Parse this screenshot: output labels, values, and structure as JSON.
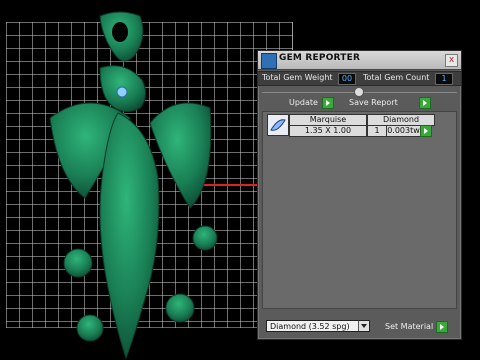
{
  "panel": {
    "title": "GEM REPORTER",
    "close_label": "x",
    "total_weight_label": "Total Gem Weight",
    "total_weight_value": "00",
    "total_count_label": "Total Gem Count",
    "total_count_value": "1",
    "update_label": "Update",
    "save_report_label": "Save Report"
  },
  "gem_row": {
    "cut": "Marquise",
    "size": "1.35 X 1.00",
    "material": "Diamond",
    "count": "1",
    "weight": "0.003tw"
  },
  "material_select": {
    "value": "Diamond   (3.52 spg)"
  },
  "set_material_label": "Set Material",
  "colors": {
    "model_green": "#1f8a5b",
    "grid_line": "#c8c8c8",
    "axis_red": "#dd2222",
    "panel_bg": "#5b5b5b",
    "value_blue": "#4fb3ff",
    "go_green": "#3aa83a"
  },
  "icons": {
    "title": "gem-reporter-icon",
    "close": "close-icon",
    "go": "play-arrow-icon",
    "thumb": "marquise-gem-icon",
    "dropdown": "chevron-down-icon"
  }
}
